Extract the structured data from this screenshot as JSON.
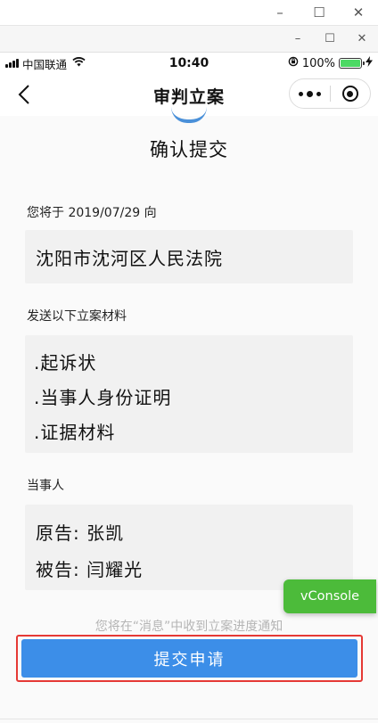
{
  "window": {
    "controls": [
      "–",
      "☐",
      "✕"
    ],
    "controls_small": [
      "–",
      "☐",
      "✕"
    ]
  },
  "status_bar": {
    "carrier": "中国联通",
    "time": "10:40",
    "battery_pct": "100%",
    "battery_level": 1.0
  },
  "nav": {
    "title": "审判立案"
  },
  "page": {
    "title": "确认提交",
    "court_label": "您将于 2019/07/29 向",
    "court_name": "沈阳市沈河区人民法院",
    "materials_label": "发送以下立案材料",
    "materials": [
      ".起诉状",
      ".当事人身份证明",
      ".证据材料"
    ],
    "parties_label": "当事人",
    "plaintiff": "原告:  张凯",
    "defendant": "被告:  闫耀光"
  },
  "vconsole": {
    "label": "vConsole"
  },
  "footer": {
    "notice": "您将在“消息”中收到立案进度通知",
    "submit_label": "提交申请"
  },
  "colors": {
    "primary": "#3c8ee8",
    "highlight": "#e53935",
    "vconsole": "#4cbb3a",
    "battery": "#4cd964"
  }
}
